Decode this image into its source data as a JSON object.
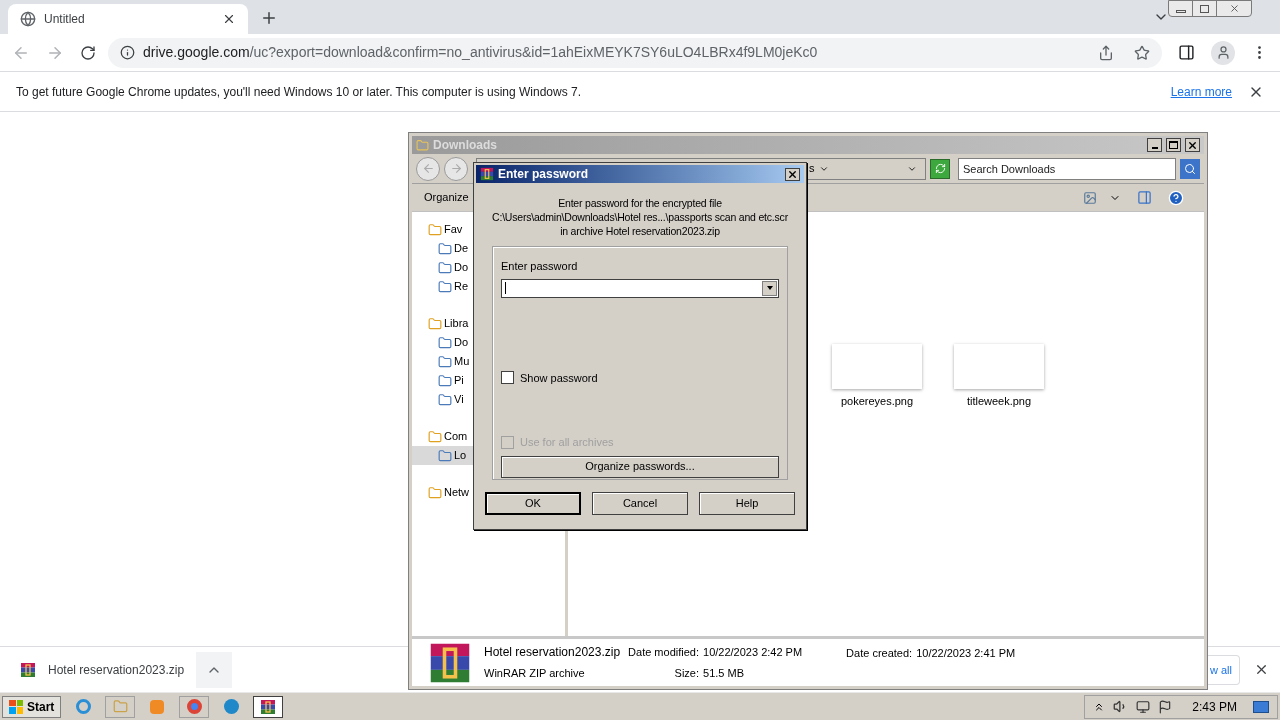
{
  "browser": {
    "tab": {
      "title": "Untitled"
    },
    "url": {
      "host": "drive.google.com",
      "path": "/uc?export=download&confirm=no_antivirus&id=1ahEixMEYK7SY6uLO4LBRx4f9LM0jeKc0"
    },
    "infobar": {
      "message": "To get future Google Chrome updates, you'll need Windows 10 or later. This computer is using Windows 7.",
      "link": "Learn more"
    },
    "download_bar": {
      "file": "Hotel reservation2023.zip",
      "show_all": "w all"
    }
  },
  "explorer": {
    "title": "Downloads",
    "address_fragment": "s",
    "search": {
      "placeholder": "Search Downloads"
    },
    "toolbar": [
      "Organize"
    ],
    "sidebar": [
      {
        "kind": "header",
        "label": "Fav",
        "selected": false
      },
      {
        "kind": "item",
        "label": "De",
        "selected": false
      },
      {
        "kind": "item",
        "label": "Do",
        "selected": false
      },
      {
        "kind": "item",
        "label": "Re",
        "selected": false
      },
      {
        "kind": "header",
        "label": "Libra",
        "selected": false
      },
      {
        "kind": "item",
        "label": "Do",
        "selected": false
      },
      {
        "kind": "item",
        "label": "Mu",
        "selected": false
      },
      {
        "kind": "item",
        "label": "Pi",
        "selected": false
      },
      {
        "kind": "item",
        "label": "Vi",
        "selected": false
      },
      {
        "kind": "header",
        "label": "Com",
        "selected": false
      },
      {
        "kind": "item",
        "label": "Lo",
        "selected": true
      },
      {
        "kind": "header",
        "label": "Netw",
        "selected": false
      }
    ],
    "files": [
      {
        "name": "pokereyes.png"
      },
      {
        "name": "titleweek.png"
      }
    ],
    "details": {
      "name": "Hotel reservation2023.zip",
      "type": "WinRAR ZIP archive",
      "fields": [
        {
          "label": "Date modified:",
          "value": "10/22/2023 2:42 PM"
        },
        {
          "label": "Size:",
          "value": "51.5 MB"
        },
        {
          "label": "Date created:",
          "value": "10/22/2023 2:41 PM"
        }
      ]
    }
  },
  "dialog": {
    "title": "Enter password",
    "message": [
      "Enter password for the encrypted file",
      "C:\\Users\\admin\\Downloads\\Hotel res...\\passports scan and etc.scr",
      "in archive Hotel reservation2023.zip"
    ],
    "password_label": "Enter password",
    "show_password": {
      "label": "Show password",
      "checked": false,
      "disabled": false
    },
    "use_for_all": {
      "label": "Use for all archives",
      "checked": false,
      "disabled": true
    },
    "organize_button": "Organize passwords...",
    "buttons": [
      {
        "label": "OK",
        "default": true
      },
      {
        "label": "Cancel",
        "default": false
      },
      {
        "label": "Help",
        "default": false
      }
    ]
  },
  "taskbar": {
    "start": "Start",
    "clock": "2:43 PM"
  }
}
